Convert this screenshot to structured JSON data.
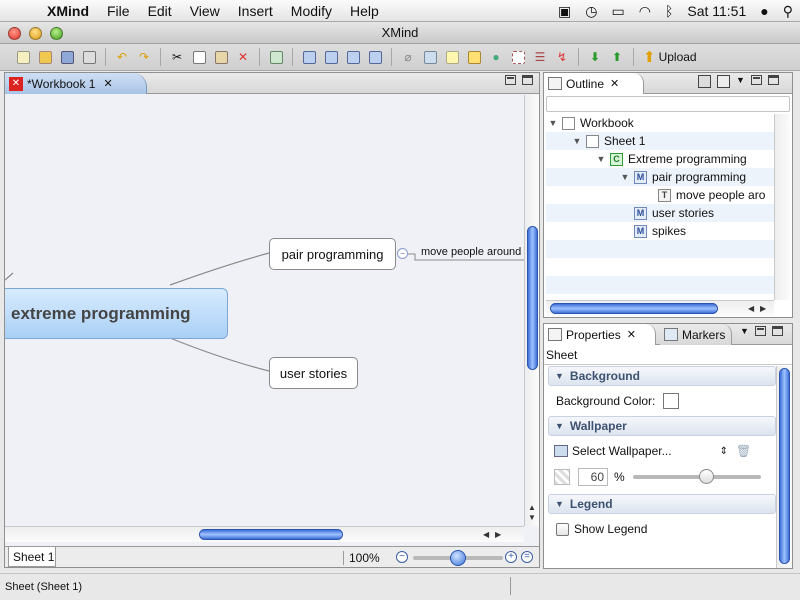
{
  "menubar": {
    "app_name": "XMind",
    "items": [
      "File",
      "Edit",
      "View",
      "Insert",
      "Modify",
      "Help"
    ],
    "clock": "Sat 11:51"
  },
  "window": {
    "title": "XMind"
  },
  "toolbar": {
    "upload_label": "Upload"
  },
  "editor": {
    "tab_title": "*Workbook 1",
    "central_topic": "extreme programming",
    "topics": [
      "pair programming",
      "user stories"
    ],
    "subtopic": "move people around",
    "sheet_tab": "Sheet 1",
    "zoom": "100%"
  },
  "outline": {
    "tab_title": "Outline",
    "tree": [
      {
        "label": "Workbook",
        "icon": "workbook-icon"
      },
      {
        "label": "Sheet 1",
        "icon": "sheet-icon"
      },
      {
        "label": "Extreme programming",
        "icon": "central-topic-icon"
      },
      {
        "label": "pair programming",
        "icon": "main-topic-icon"
      },
      {
        "label": "move people aro",
        "icon": "subtopic-icon"
      },
      {
        "label": "user stories",
        "icon": "main-topic-icon"
      },
      {
        "label": "spikes",
        "icon": "main-topic-icon"
      }
    ]
  },
  "properties": {
    "tab_title": "Properties",
    "markers_tab": "Markers",
    "subject": "Sheet",
    "sections": {
      "background": "Background",
      "background_color_label": "Background Color:",
      "wallpaper": "Wallpaper",
      "select_wallpaper": "Select Wallpaper...",
      "opacity_value": "60",
      "opacity_unit": "%",
      "legend": "Legend",
      "show_legend": "Show Legend"
    }
  },
  "status": {
    "text": "Sheet (Sheet 1)"
  }
}
